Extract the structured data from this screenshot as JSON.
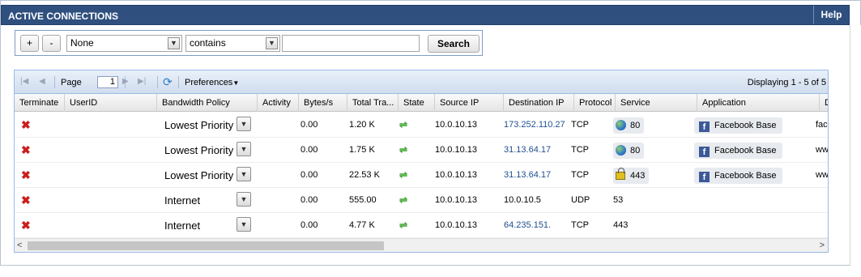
{
  "panel": {
    "title": "ACTIVE CONNECTIONS",
    "help_label": "Help"
  },
  "filter": {
    "add_label": "+",
    "remove_label": "-",
    "field_value": "None",
    "operator_value": "contains",
    "text_value": "",
    "search_label": "Search"
  },
  "pager": {
    "page_label": "Page",
    "page_value": "1",
    "preferences_label": "Preferences",
    "display_text": "Displaying 1 - 5 of 5"
  },
  "columns": [
    "Terminate",
    "UserID",
    "Bandwidth Policy",
    "Activity",
    "Bytes/s",
    "Total Tra...",
    "State",
    "Source IP",
    "Destination IP",
    "Protocol",
    "Service",
    "Application",
    "D"
  ],
  "rows": [
    {
      "userid": "",
      "policy": "Lowest Priority",
      "activity": "",
      "bytes": "0.00",
      "total": "1.20 K",
      "source": "10.0.10.13",
      "dest": "173.252.110.27",
      "protocol": "TCP",
      "service": "80",
      "service_icon": "globe-icon",
      "application": "Facebook Base",
      "extra": "fac"
    },
    {
      "userid": "",
      "policy": "Lowest Priority",
      "activity": "",
      "bytes": "0.00",
      "total": "1.75 K",
      "source": "10.0.10.13",
      "dest": "31.13.64.17",
      "protocol": "TCP",
      "service": "80",
      "service_icon": "globe-icon",
      "application": "Facebook Base",
      "extra": "ww"
    },
    {
      "userid": "",
      "policy": "Lowest Priority",
      "activity": "",
      "bytes": "0.00",
      "total": "22.53 K",
      "source": "10.0.10.13",
      "dest": "31.13.64.17",
      "protocol": "TCP",
      "service": "443",
      "service_icon": "lock-icon",
      "application": "Facebook Base",
      "extra": "ww"
    },
    {
      "userid": "",
      "policy": "Internet",
      "activity": "",
      "bytes": "0.00",
      "total": "555.00",
      "source": "10.0.10.13",
      "dest": "10.0.10.5",
      "protocol": "UDP",
      "service": "53",
      "service_icon": "",
      "application": "",
      "extra": ""
    },
    {
      "userid": "",
      "policy": "Internet",
      "activity": "",
      "bytes": "0.00",
      "total": "4.77 K",
      "source": "10.0.10.13",
      "dest": "64.235.151.",
      "protocol": "TCP",
      "service": "443",
      "service_icon": "",
      "application": "",
      "extra": ""
    }
  ],
  "colors": {
    "titlebar": "#2f4f7f",
    "link": "#1f4f8f",
    "terminate": "#cc1f1f",
    "state": "#3aa32a"
  }
}
